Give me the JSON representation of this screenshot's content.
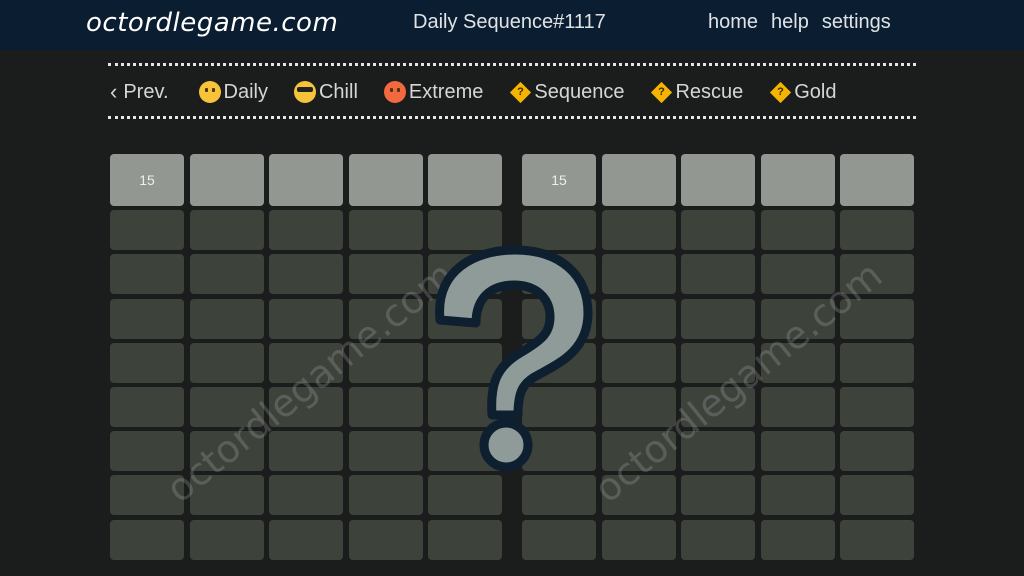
{
  "header": {
    "brand": "octordlegame.com",
    "title": "Daily Sequence#1117",
    "nav": [
      "home",
      "help",
      "settings"
    ]
  },
  "modes": [
    {
      "label": "Prev.",
      "icon": "chevron-left-icon"
    },
    {
      "label": "Daily",
      "icon": "smile-emoji-icon"
    },
    {
      "label": "Chill",
      "icon": "sunglasses-emoji-icon"
    },
    {
      "label": "Extreme",
      "icon": "hot-face-emoji-icon"
    },
    {
      "label": "Sequence",
      "icon": "question-diamond-icon"
    },
    {
      "label": "Rescue",
      "icon": "question-diamond-icon"
    },
    {
      "label": "Gold",
      "icon": "question-diamond-icon"
    }
  ],
  "boards": [
    {
      "hint_cells": [
        "15",
        "",
        "",
        "",
        ""
      ],
      "rows": 8
    },
    {
      "hint_cells": [
        "15",
        "",
        "",
        "",
        ""
      ],
      "rows": 8
    }
  ],
  "watermark": "octordlegame.com",
  "overlay_symbol": "?",
  "colors": {
    "header_bg": "#0b1d30",
    "page_bg": "#1b1c1c",
    "hint_cell": "#929791",
    "empty_cell": "#3d423b",
    "question_fill": "#8f9b98",
    "question_outline": "#0e1f30"
  }
}
